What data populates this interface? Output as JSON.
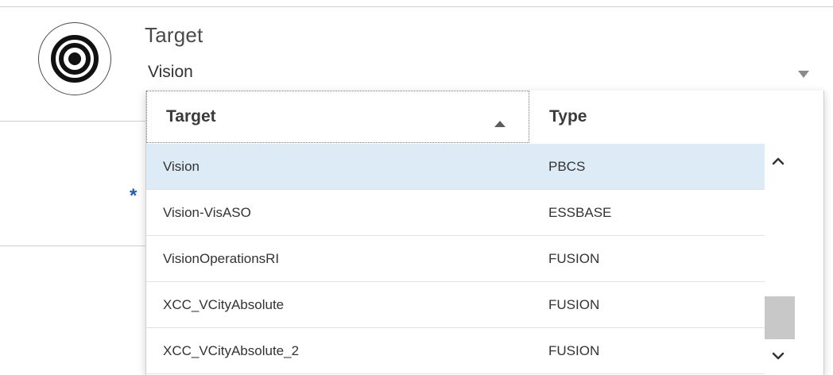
{
  "field": {
    "label": "Target",
    "value": "Vision",
    "required_marker": "*"
  },
  "icons": {
    "field_icon": "target-icon",
    "dropdown": "caret-down-icon",
    "sort": "sort-ascending-icon",
    "scroll_up": "chevron-up-icon",
    "scroll_down": "chevron-down-icon"
  },
  "colors": {
    "selected_row": "#ddebf6",
    "required_marker": "#1c5fa8",
    "scroll_thumb": "#c8c8c8"
  },
  "table": {
    "columns": [
      "Target",
      "Type"
    ],
    "sort": {
      "column": "Target",
      "direction": "ascending"
    },
    "rows": [
      {
        "name": "Vision",
        "type": "PBCS",
        "selected": true
      },
      {
        "name": "Vision-VisASO",
        "type": "ESSBASE",
        "selected": false
      },
      {
        "name": "VisionOperationsRI",
        "type": "FUSION",
        "selected": false
      },
      {
        "name": "XCC_VCityAbsolute",
        "type": "FUSION",
        "selected": false
      },
      {
        "name": "XCC_VCityAbsolute_2",
        "type": "FUSION",
        "selected": false
      }
    ]
  }
}
